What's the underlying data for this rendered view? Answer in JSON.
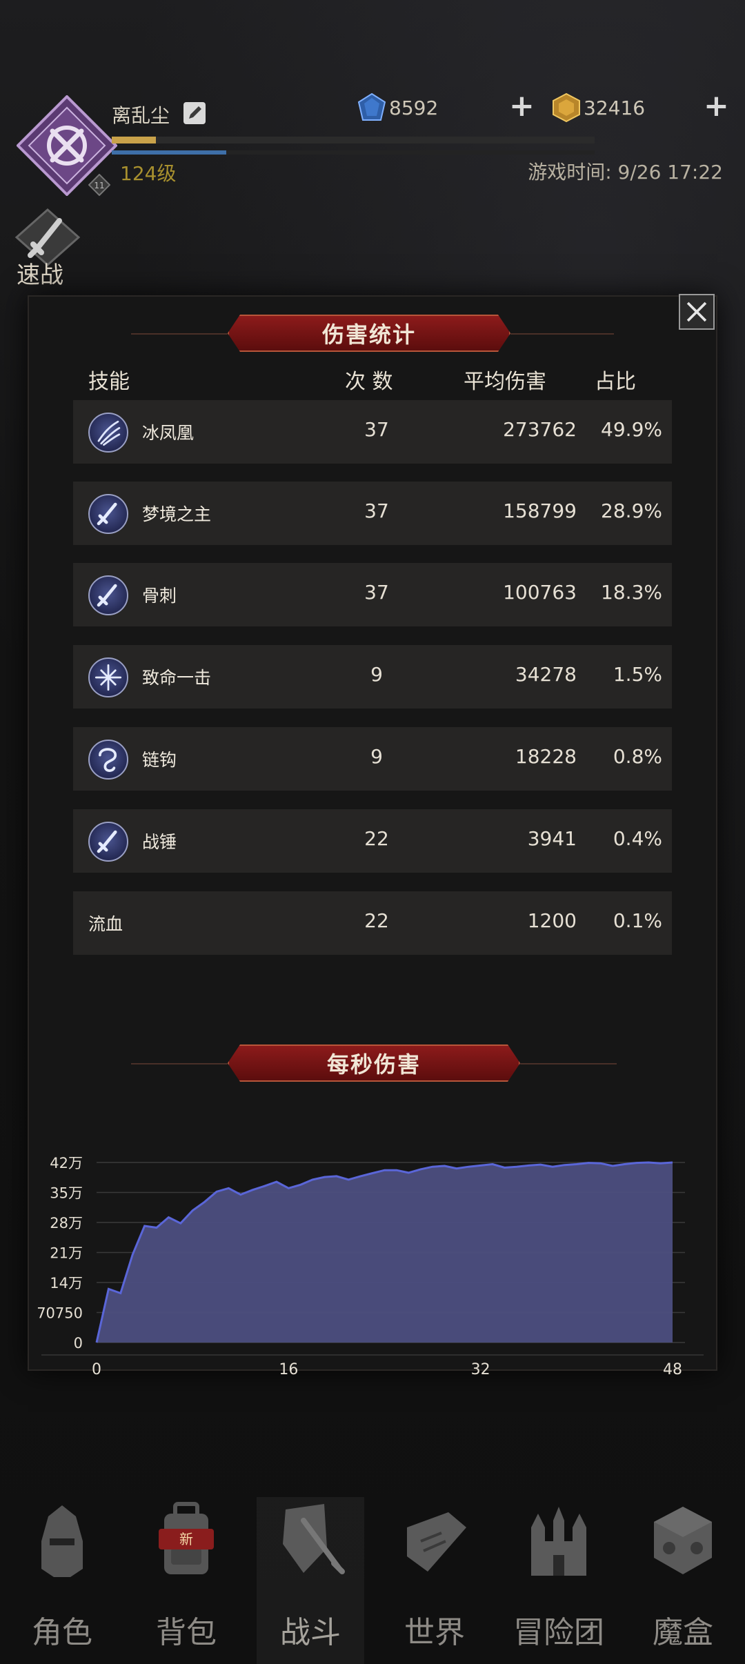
{
  "header": {
    "player_name": "离乱尘",
    "level": "124级",
    "rank": "11",
    "gems": "8592",
    "gold": "32416",
    "game_time": "游戏时间: 9/26 17:22",
    "quick_battle": "速战"
  },
  "panel": {
    "title": "伤害统计",
    "columns": {
      "skill": "技能",
      "count": "次 数",
      "avg": "平均伤害",
      "share": "占比"
    },
    "rows": [
      {
        "name": "冰凤凰",
        "count": "37",
        "avg": "273762",
        "share": "49.9%",
        "icon": "ice-phoenix-icon"
      },
      {
        "name": "梦境之主",
        "count": "37",
        "avg": "158799",
        "share": "28.9%",
        "icon": "dagger-icon"
      },
      {
        "name": "骨刺",
        "count": "37",
        "avg": "100763",
        "share": "18.3%",
        "icon": "dagger-icon"
      },
      {
        "name": "致命一击",
        "count": "9",
        "avg": "34278",
        "share": "1.5%",
        "icon": "critical-strike-icon"
      },
      {
        "name": "链钩",
        "count": "9",
        "avg": "18228",
        "share": "0.8%",
        "icon": "chain-hook-icon"
      },
      {
        "name": "战锤",
        "count": "22",
        "avg": "3941",
        "share": "0.4%",
        "icon": "dagger-icon"
      },
      {
        "name": "流血",
        "count": "22",
        "avg": "1200",
        "share": "0.1%",
        "icon": ""
      }
    ],
    "dps_title": "每秒伤害"
  },
  "chart_data": {
    "type": "area",
    "title": "每秒伤害",
    "x_ticks": [
      "0",
      "16",
      "32",
      "48"
    ],
    "y_ticks": [
      "0",
      "70750",
      "14万",
      "21万",
      "28万",
      "35万",
      "42万"
    ],
    "xlim": [
      0,
      48
    ],
    "ylim": [
      0,
      420000
    ],
    "grid": true,
    "color": "#4c4e7f",
    "x": [
      0,
      1,
      2,
      3,
      4,
      5,
      6,
      7,
      8,
      9,
      10,
      11,
      12,
      13,
      14,
      15,
      16,
      17,
      18,
      19,
      20,
      21,
      22,
      23,
      24,
      25,
      26,
      27,
      28,
      29,
      30,
      31,
      32,
      33,
      34,
      35,
      36,
      37,
      38,
      39,
      40,
      41,
      42,
      43,
      44,
      45,
      46,
      47,
      48
    ],
    "y": [
      0,
      125000,
      115000,
      205000,
      272000,
      268000,
      292000,
      278000,
      308000,
      328000,
      352000,
      360000,
      345000,
      356000,
      365000,
      375000,
      360000,
      368000,
      380000,
      386000,
      388000,
      380000,
      388000,
      395000,
      402000,
      402000,
      396000,
      404000,
      410000,
      412000,
      406000,
      410000,
      413000,
      416000,
      408000,
      410000,
      413000,
      415000,
      410000,
      414000,
      416000,
      419000,
      418000,
      412000,
      416000,
      419000,
      420000,
      418000,
      420000
    ]
  },
  "nav": [
    {
      "label": "角色",
      "icon": "helmet-icon"
    },
    {
      "label": "背包",
      "icon": "backpack-icon",
      "badge": "新"
    },
    {
      "label": "战斗",
      "icon": "shield-sword-icon"
    },
    {
      "label": "世界",
      "icon": "map-scroll-icon"
    },
    {
      "label": "冒险团",
      "icon": "castle-icon"
    },
    {
      "label": "魔盒",
      "icon": "magic-cube-icon"
    }
  ],
  "colors": {
    "title_red": "#8c1b1b",
    "gold_text": "#a8902e",
    "row_bg": "#262524",
    "area": "#4c4e7f"
  }
}
